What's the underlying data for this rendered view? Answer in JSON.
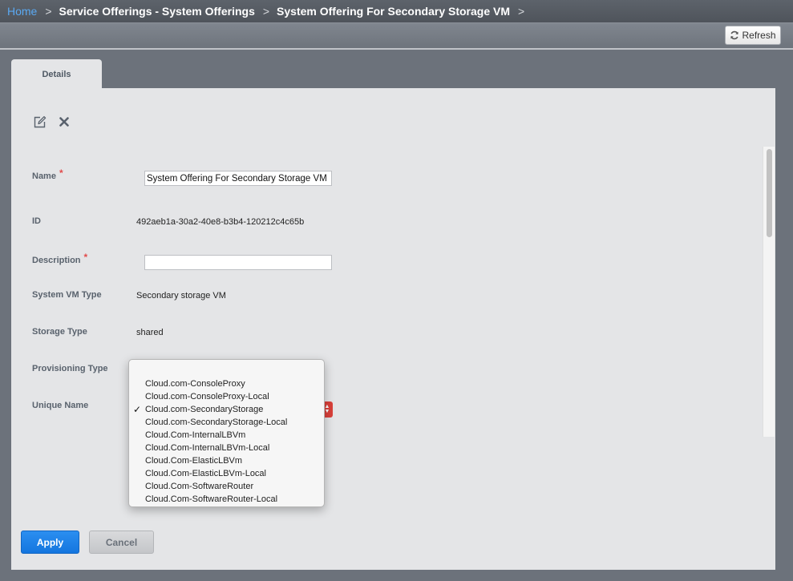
{
  "breadcrumb": {
    "items": [
      "Home",
      "Service Offerings - System Offerings",
      "System Offering For Secondary Storage VM"
    ],
    "separator": ">"
  },
  "toolbar": {
    "refresh_label": "Refresh"
  },
  "tabs": [
    {
      "label": "Details"
    }
  ],
  "actions": {
    "edit_icon": "edit-icon",
    "delete_icon": "close-icon"
  },
  "fields": {
    "name": {
      "label": "Name",
      "required_mark": "*",
      "value": "System Offering For Secondary Storage VM"
    },
    "id": {
      "label": "ID",
      "value": "492aeb1a-30a2-40e8-b3b4-120212c4c65b"
    },
    "description": {
      "label": "Description",
      "required_mark": "*",
      "value": ""
    },
    "system_vm_type": {
      "label": "System VM Type",
      "value": "Secondary storage VM"
    },
    "storage_type": {
      "label": "Storage Type",
      "value": "shared"
    },
    "provisioning_type": {
      "label": "Provisioning Type"
    },
    "unique_name": {
      "label": "Unique Name"
    }
  },
  "dropdown": {
    "selected_index": 2,
    "options": [
      "Cloud.com-ConsoleProxy",
      "Cloud.com-ConsoleProxy-Local",
      "Cloud.com-SecondaryStorage",
      "Cloud.com-SecondaryStorage-Local",
      "Cloud.Com-InternalLBVm",
      "Cloud.Com-InternalLBVm-Local",
      "Cloud.Com-ElasticLBVm",
      "Cloud.Com-ElasticLBVm-Local",
      "Cloud.Com-SoftwareRouter",
      "Cloud.Com-SoftwareRouter-Local"
    ],
    "check_mark": "✓"
  },
  "buttons": {
    "apply_label": "Apply",
    "cancel_label": "Cancel"
  },
  "colors": {
    "accent": "#1a7fe6",
    "link": "#5aa9f2",
    "required": "#e24b4b",
    "select_stepper": "#d9403a"
  }
}
